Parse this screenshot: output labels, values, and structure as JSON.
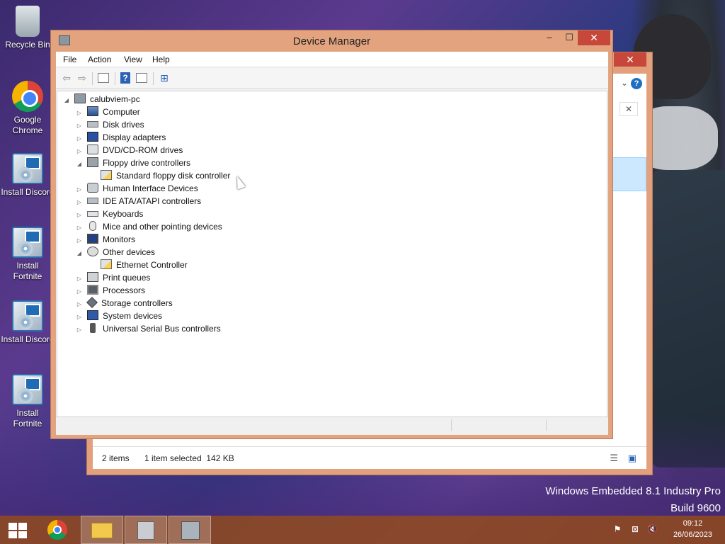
{
  "desktop": {
    "icons": [
      {
        "label": "Recycle Bin",
        "icon": "recycle-bin-icon"
      },
      {
        "label": "Google Chrome",
        "icon": "chrome-icon"
      },
      {
        "label": "Install Discord",
        "icon": "installer-icon"
      },
      {
        "label": "Install Fortnite",
        "icon": "installer-icon"
      },
      {
        "label": "Install Discord",
        "icon": "installer-icon"
      },
      {
        "label": "Install Fortnite",
        "icon": "installer-icon"
      }
    ],
    "watermark_line1": "Windows Embedded 8.1 Industry Pro",
    "watermark_line2": "Build 9600"
  },
  "background_window": {
    "status_items": "2 items",
    "status_selected": "1 item selected  142 KB"
  },
  "device_manager": {
    "title": "Device Manager",
    "menu": [
      "File",
      "Action",
      "View",
      "Help"
    ],
    "window_buttons": {
      "minimize": "–",
      "maximize": "☐",
      "close": "✕"
    },
    "tree": {
      "root": "calubviem-pc",
      "nodes": [
        {
          "label": "Computer",
          "icon": "computer-icon",
          "expanded": false
        },
        {
          "label": "Disk drives",
          "icon": "disk-drive-icon",
          "expanded": false
        },
        {
          "label": "Display adapters",
          "icon": "display-adapter-icon",
          "expanded": false
        },
        {
          "label": "DVD/CD-ROM drives",
          "icon": "dvd-drive-icon",
          "expanded": false
        },
        {
          "label": "Floppy drive controllers",
          "icon": "floppy-controller-icon",
          "expanded": true
        },
        {
          "label": "Standard floppy disk controller",
          "icon": "warning-device-icon",
          "child": true
        },
        {
          "label": "Human Interface Devices",
          "icon": "hid-icon",
          "expanded": false
        },
        {
          "label": "IDE ATA/ATAPI controllers",
          "icon": "ide-controller-icon",
          "expanded": false
        },
        {
          "label": "Keyboards",
          "icon": "keyboard-icon",
          "expanded": false
        },
        {
          "label": "Mice and other pointing devices",
          "icon": "mouse-icon",
          "expanded": false
        },
        {
          "label": "Monitors",
          "icon": "monitor-icon",
          "expanded": false
        },
        {
          "label": "Other devices",
          "icon": "unknown-device-icon",
          "expanded": true
        },
        {
          "label": "Ethernet Controller",
          "icon": "warning-device-icon",
          "child": true
        },
        {
          "label": "Print queues",
          "icon": "printer-icon",
          "expanded": false
        },
        {
          "label": "Processors",
          "icon": "processor-icon",
          "expanded": false
        },
        {
          "label": "Storage controllers",
          "icon": "storage-controller-icon",
          "expanded": false
        },
        {
          "label": "System devices",
          "icon": "system-device-icon",
          "expanded": false
        },
        {
          "label": "Universal Serial Bus controllers",
          "icon": "usb-icon",
          "expanded": false
        }
      ]
    }
  },
  "taskbar": {
    "clock_time": "09:12",
    "clock_date": "26/06/2023",
    "pinned": [
      "start-button",
      "chrome",
      "file-explorer",
      "installer",
      "device-manager"
    ]
  },
  "colors": {
    "title_bar": "#e3a37f",
    "close_button": "#c7473a",
    "taskbar": "#8c4824"
  }
}
